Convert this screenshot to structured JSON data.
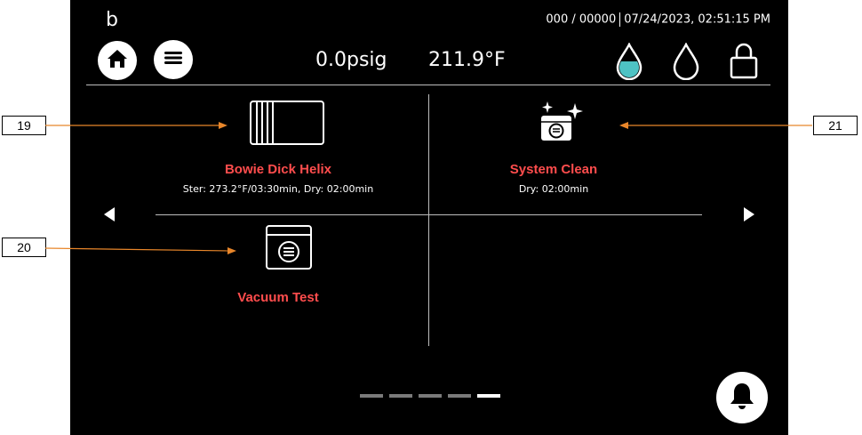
{
  "header": {
    "logo": "b",
    "counter": "000 / 00000",
    "datetime": "07/24/2023, 02:51:15 PM",
    "pressure": "0.0psig",
    "temperature": "211.9°F"
  },
  "cycles": [
    {
      "name": "Bowie Dick Helix",
      "detail": "Ster: 273.2°F/03:30min, Dry: 02:00min",
      "icon": "helix-pack-icon"
    },
    {
      "name": "System Clean",
      "detail": "Dry: 02:00min",
      "icon": "sparkle-chamber-icon"
    },
    {
      "name": "Vacuum Test",
      "detail": "",
      "icon": "vacuum-chamber-icon"
    }
  ],
  "pagination": {
    "pages": 5,
    "active_index": 4
  },
  "callouts": [
    "19",
    "20",
    "21"
  ],
  "colors": {
    "accent_red": "#ff4d4d",
    "water_teal": "#4ec3c4",
    "background": "#000000"
  }
}
